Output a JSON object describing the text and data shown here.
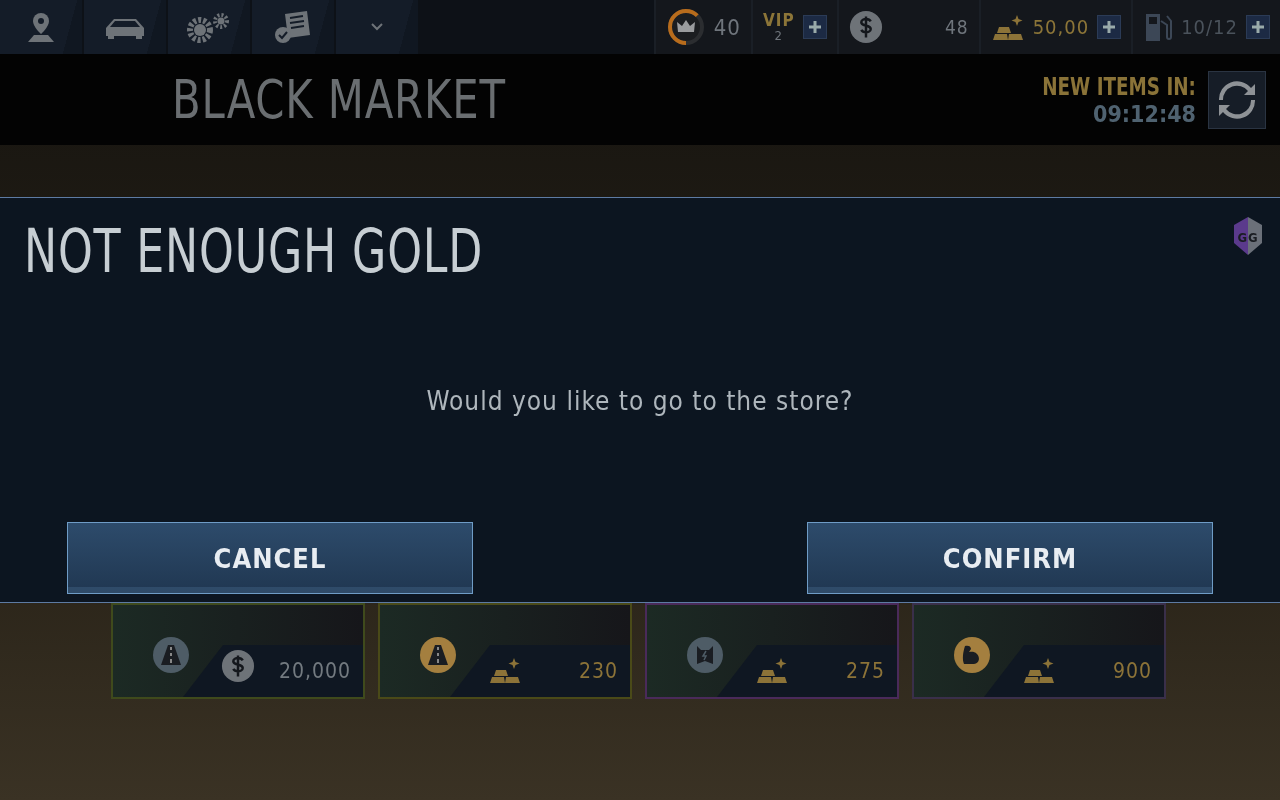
{
  "nav_tabs": [
    {
      "kind": "pin"
    },
    {
      "kind": "car"
    },
    {
      "kind": "gears"
    },
    {
      "kind": "checklist"
    },
    {
      "kind": "chevron"
    }
  ],
  "stats": {
    "rank": {
      "value": "40",
      "level": 0.62
    },
    "vip": {
      "label": "VIP",
      "tier": "2"
    },
    "cash": {
      "value": "48"
    },
    "gold": {
      "value": "50,00"
    },
    "fuel": {
      "value": "10/12"
    }
  },
  "header": {
    "title": "BLACK MARKET",
    "timer_label": "NEW ITEMS IN:",
    "timer_value": "09:12:48"
  },
  "dialog": {
    "title": "NOT ENOUGH GOLD",
    "badge": "GG",
    "message": "Would you like to go to the store?",
    "buttons": [
      "CANCEL",
      "CONFIRM"
    ]
  },
  "cards": [
    {
      "color": "#3f4a1c",
      "badge": {
        "kind": "road",
        "highlighted": false
      },
      "currency": {
        "kind": "cash"
      },
      "price": "20,000"
    },
    {
      "color": "#4a4a18",
      "badge": {
        "kind": "road",
        "highlighted": true
      },
      "currency": {
        "kind": "gold"
      },
      "price": "230"
    },
    {
      "color": "#4a2a5a",
      "badge": {
        "kind": "mask",
        "highlighted": false
      },
      "currency": {
        "kind": "gold"
      },
      "price": "275"
    },
    {
      "color": "#3a2f4a",
      "badge": {
        "kind": "muscle",
        "highlighted": true
      },
      "currency": {
        "kind": "gold"
      },
      "price": "900"
    }
  ]
}
